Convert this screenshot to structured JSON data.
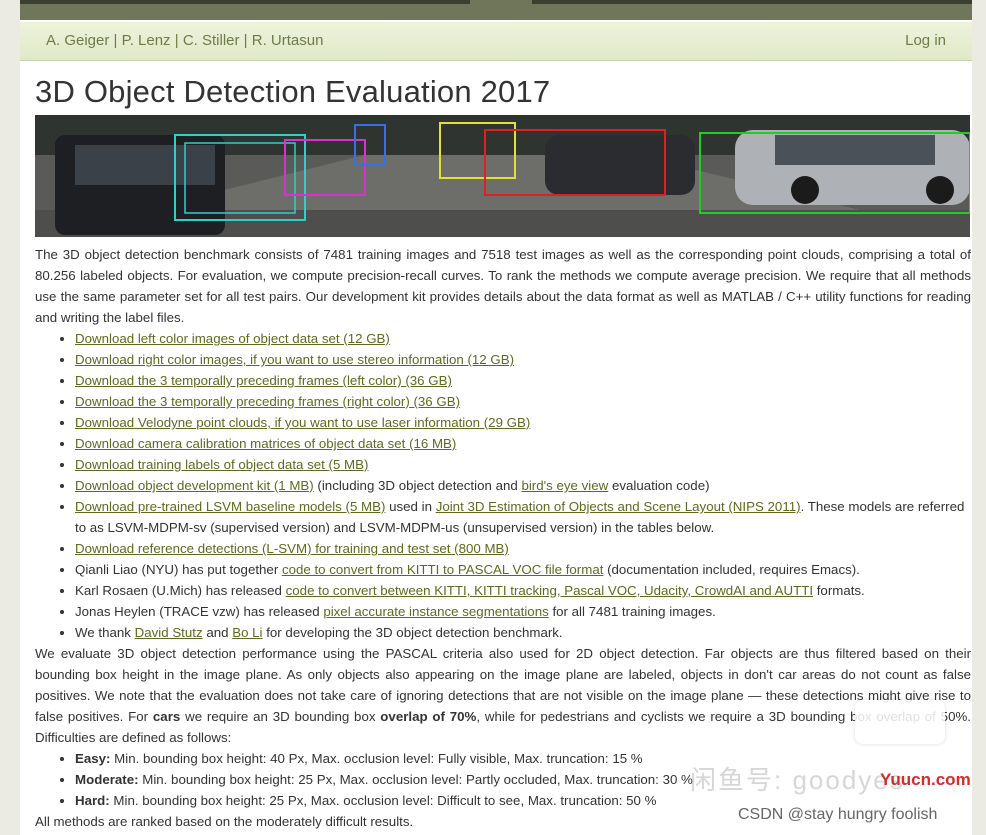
{
  "header": {
    "authors": [
      "A. Geiger",
      "P. Lenz",
      "C. Stiller",
      "R. Urtasun"
    ],
    "separator": "|",
    "login": "Log in"
  },
  "title": "3D Object Detection Evaluation 2017",
  "intro": "The 3D object detection benchmark consists of 7481 training images and 7518 test images as well as the corresponding point clouds, comprising a total of 80.256 labeled objects. For evaluation, we compute precision-recall curves. To rank the methods we compute average precision. We require that all methods use the same parameter set for all test pairs. Our development kit provides details about the data format as well as MATLAB / C++ utility functions for reading and writing the label files.",
  "links": [
    {
      "text": "Download left color images of object data set (12 GB)"
    },
    {
      "text": "Download right color images, if you want to use stereo information (12 GB)"
    },
    {
      "text": "Download the 3 temporally preceding frames (left color) (36 GB)"
    },
    {
      "text": "Download the 3 temporally preceding frames (right color) (36 GB)"
    },
    {
      "text": "Download Velodyne point clouds, if you want to use laser information (29 GB)"
    },
    {
      "text": "Download camera calibration matrices of object data set (16 MB)"
    },
    {
      "text": "Download training labels of object data set (5 MB)"
    }
  ],
  "devkit": {
    "link": "Download object development kit (1 MB)",
    "mid": " (including 3D object detection and ",
    "link2": "bird's eye view",
    "end": " evaluation code)"
  },
  "lsvm": {
    "link": "Download pre-trained LSVM baseline models (5 MB)",
    "mid": " used in ",
    "link2": "Joint 3D Estimation of Objects and Scene Layout (NIPS 2011)",
    "end": ". These models are referred to as LSVM-MDPM-sv (supervised version) and LSVM-MDPM-us (unsupervised version) in the tables below."
  },
  "refdet": {
    "link": "Download reference detections (L-SVM) for training and test set (800 MB)"
  },
  "qianli": {
    "pre": "Qianli Liao (NYU) has put together ",
    "link": "code to convert from KITTI to PASCAL VOC file format",
    "end": " (documentation included, requires Emacs)."
  },
  "karl": {
    "pre": "Karl Rosaen (U.Mich) has released ",
    "link": "code to convert between KITTI, KITTI tracking, Pascal VOC, Udacity, CrowdAI and AUTTI",
    "end": " formats."
  },
  "jonas": {
    "pre": "Jonas Heylen (TRACE vzw) has released ",
    "link": "pixel accurate instance segmentations",
    "end": " for all 7481 training images."
  },
  "thanks": {
    "pre": "We thank ",
    "link1": "David Stutz",
    "mid": " and ",
    "link2": "Bo Li",
    "end": " for developing the 3D object detection benchmark."
  },
  "eval": {
    "p1": "We evaluate 3D object detection performance using the PASCAL criteria also used for 2D object detection. Far objects are thus filtered based on their bounding box height in the image plane. As only objects also appearing on the image plane are labeled, objects in don't car areas do not count as false positives. We note that the evaluation does not take care of ignoring detections that are not visible on the image plane — these detections might give rise to false positives. For ",
    "b1": "cars",
    "p2": " we require an 3D bounding box ",
    "b2": "overlap of 70%",
    "p3": ", while for pedestrians and cyclists we require a 3D bounding box overlap of 50%. Difficulties are defined as follows:"
  },
  "difficulties": [
    {
      "label": "Easy:",
      "text": " Min. bounding box height: 40 Px, Max. occlusion level: Fully visible, Max. truncation: 15 %"
    },
    {
      "label": "Moderate:",
      "text": " Min. bounding box height: 25 Px, Max. occlusion level: Partly occluded, Max. truncation: 30 %"
    },
    {
      "label": "Hard:",
      "text": " Min. bounding box height: 25 Px, Max. occlusion level: Difficult to see, Max. truncation: 50 %"
    }
  ],
  "footer_text": "All methods are ranked based on the moderately difficult results.",
  "watermarks": {
    "text1": "闲鱼号: goodyes",
    "text2": "Yuucn.com",
    "text3": "CSDN @stay hungry foolish"
  },
  "colors": {
    "link": "#5c6b1f",
    "nav_text": "#6f7a4a",
    "topbar": "#6f7659",
    "nav_bg": "#e4ecce"
  }
}
